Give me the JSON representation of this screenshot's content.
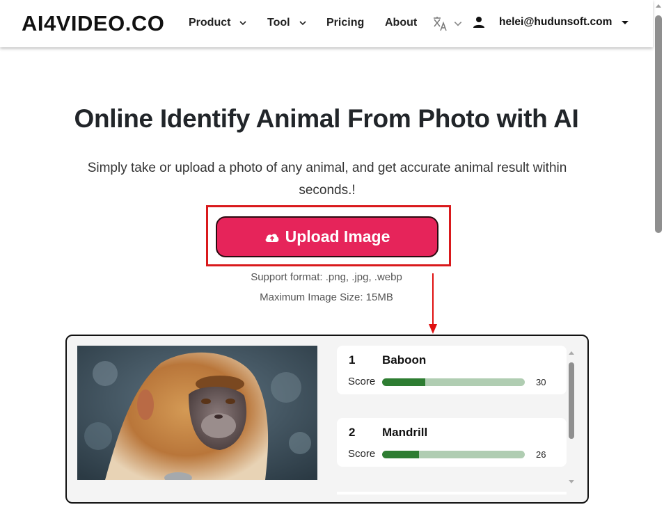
{
  "header": {
    "logo": "AI4VIDEO.CO",
    "nav": [
      {
        "label": "Product",
        "has_dropdown": true
      },
      {
        "label": "Tool",
        "has_dropdown": true
      },
      {
        "label": "Pricing",
        "has_dropdown": false
      },
      {
        "label": "About",
        "has_dropdown": false
      }
    ],
    "language_icon": "translate-icon",
    "user_icon": "person-icon",
    "user_email": "helei@hudunsoft.com"
  },
  "hero": {
    "title": "Online Identify Animal From Photo with AI",
    "subtitle": "Simply take or upload a photo of any animal, and get accurate animal result within seconds.!",
    "upload_button": {
      "label": "Upload Image",
      "icon": "cloud-upload-icon",
      "color": "#e6245a"
    },
    "support_format": "Support format: .png, .jpg, .webp",
    "max_size": "Maximum Image Size: 15MB"
  },
  "annotation": {
    "highlight_color": "#d9191c"
  },
  "result": {
    "photo_alt": "monkey photo",
    "score_label": "Score",
    "bar_fill_color": "#2e7d32",
    "bar_track_color": "#b0cdb2",
    "items": [
      {
        "rank": "1",
        "name": "Baboon",
        "score": 30
      },
      {
        "rank": "2",
        "name": "Mandrill",
        "score": 26
      }
    ]
  }
}
